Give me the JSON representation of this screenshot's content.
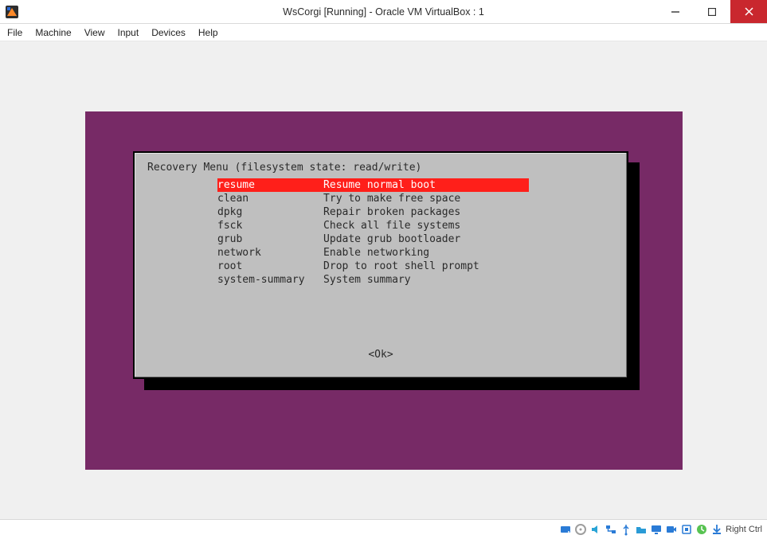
{
  "window": {
    "title": "WsCorgi [Running] - Oracle VM VirtualBox : 1"
  },
  "menubar": {
    "file": "File",
    "machine": "Machine",
    "view": "View",
    "input": "Input",
    "devices": "Devices",
    "help": "Help"
  },
  "guest": {
    "dialog_title": "Recovery Menu (filesystem state: read/write)",
    "ok_label": "<Ok>",
    "selected_index": 0,
    "items": [
      {
        "key": "resume",
        "desc": "Resume normal boot"
      },
      {
        "key": "clean",
        "desc": "Try to make free space"
      },
      {
        "key": "dpkg",
        "desc": "Repair broken packages"
      },
      {
        "key": "fsck",
        "desc": "Check all file systems"
      },
      {
        "key": "grub",
        "desc": "Update grub bootloader"
      },
      {
        "key": "network",
        "desc": "Enable networking"
      },
      {
        "key": "root",
        "desc": "Drop to root shell prompt"
      },
      {
        "key": "system-summary",
        "desc": "System summary"
      }
    ]
  },
  "statusbar": {
    "host_key": "Right Ctrl",
    "icons": [
      "harddisk-icon",
      "optical-icon",
      "audio-icon",
      "network-icon",
      "usb-icon",
      "shared-folder-icon",
      "display-icon",
      "recording-icon",
      "cpu-icon",
      "mouse-integration-icon",
      "keyboard-capture-icon"
    ]
  },
  "colors": {
    "purple": "#772a66",
    "dialog_bg": "#bfbfbf",
    "highlight": "#ff1f1a",
    "close_red": "#c9272e"
  }
}
